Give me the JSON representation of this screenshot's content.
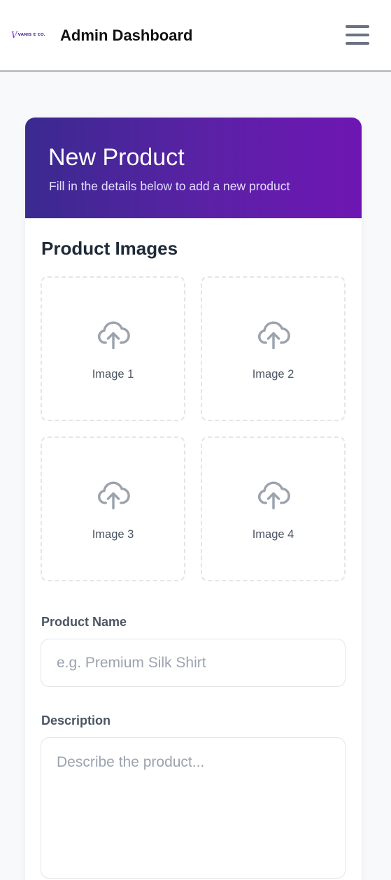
{
  "header": {
    "logo_mark": "V",
    "logo_text": "VANIS E CO.",
    "title": "Admin Dashboard",
    "menu_icon": "hamburger-menu-icon"
  },
  "form": {
    "title": "New Product",
    "subtitle": "Fill in the details below to add a new product",
    "gradient_colors": [
      "#3a2a8f",
      "#6e16b3"
    ],
    "images_section_title": "Product Images",
    "upload_icon": "cloud-upload-icon",
    "images": [
      {
        "label": "Image 1"
      },
      {
        "label": "Image 2"
      },
      {
        "label": "Image 3"
      },
      {
        "label": "Image 4"
      }
    ],
    "product_name": {
      "label": "Product Name",
      "placeholder": "e.g. Premium Silk Shirt",
      "value": ""
    },
    "description": {
      "label": "Description",
      "placeholder": "Describe the product...",
      "value": ""
    }
  }
}
